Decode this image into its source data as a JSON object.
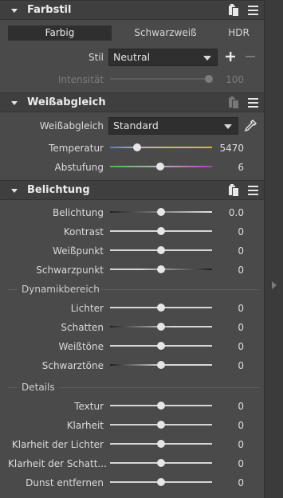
{
  "farbstil": {
    "title": "Farbstil",
    "tabs": [
      "Farbig",
      "Schwarzweiß",
      "HDR"
    ],
    "stil_label": "Stil",
    "stil_value": "Neutral",
    "intensitaet_label": "Intensität",
    "intensitaet_value": "100",
    "intensitaet_level": 1.0
  },
  "weissabgleich": {
    "title": "Weißabgleich",
    "wb_label": "Weißabgleich",
    "wb_value": "Standard",
    "temperatur_label": "Temperatur",
    "temperatur_value": "5470",
    "abstufung_label": "Abstufung",
    "abstufung_value": "6"
  },
  "belichtung": {
    "title": "Belichtung",
    "rows": [
      {
        "label": "Belichtung",
        "value": "0.0"
      },
      {
        "label": "Kontrast",
        "value": "0"
      },
      {
        "label": "Weißpunkt",
        "value": "0"
      },
      {
        "label": "Schwarzpunkt",
        "value": "0"
      }
    ],
    "dynamik_label": "Dynamikbereich",
    "dynamik_rows": [
      {
        "label": "Lichter",
        "value": "0"
      },
      {
        "label": "Schatten",
        "value": "0"
      },
      {
        "label": "Weißtöne",
        "value": "0"
      },
      {
        "label": "Schwarztöne",
        "value": "0"
      }
    ],
    "details_label": "Details",
    "details_rows": [
      {
        "label": "Textur",
        "value": "0"
      },
      {
        "label": "Klarheit",
        "value": "0"
      },
      {
        "label": "Klarheit der Lichter",
        "value": "0"
      },
      {
        "label": "Klarheit der Schatt...",
        "value": "0"
      },
      {
        "label": "Dunst entfernen",
        "value": "0"
      }
    ]
  },
  "icons": {
    "collapse": "triangle-down-icon",
    "copy": "copy-settings-icon",
    "menu": "hamburger-menu-icon",
    "add": "plus-icon",
    "remove": "minus-icon",
    "picker": "eyedropper-icon"
  },
  "colors": {
    "panel_bg": "#4a4a4a",
    "header_bg": "#3f3f3f",
    "control_bg": "#2f2f2f",
    "temperature_track": "#c8b42a",
    "tint_track_start": "#4fb84f",
    "tint_track_end": "#b43cb4"
  }
}
